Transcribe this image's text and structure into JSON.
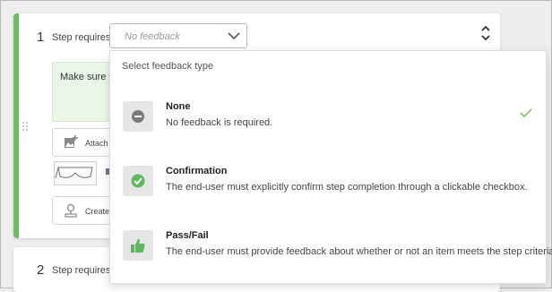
{
  "colors": {
    "accent": "#6cbf5c",
    "menu_icon_bg": "#e6e6e6",
    "check_green": "#7cc36c",
    "confirm_green": "#5cb85c"
  },
  "steps": [
    {
      "number": "1",
      "label": "Step requires",
      "feedback_value": "No feedback",
      "text_preview": "Make sure y",
      "attach_label": "Attach",
      "create_label": "Create"
    },
    {
      "number": "2",
      "label": "Step requires"
    }
  ],
  "feedback_menu": {
    "header": "Select feedback type",
    "options": [
      {
        "title": "None",
        "description": "No feedback is required.",
        "icon": "minus-circle-icon",
        "selected": true
      },
      {
        "title": "Confirmation",
        "description": "The end-user must explicitly confirm step completion through a clickable checkbox.",
        "icon": "check-circle-icon",
        "selected": false
      },
      {
        "title": "Pass/Fail",
        "description": "The end-user must provide feedback about whether or not an item meets the step criteria.",
        "icon": "thumbs-up-icon",
        "selected": false
      }
    ]
  }
}
